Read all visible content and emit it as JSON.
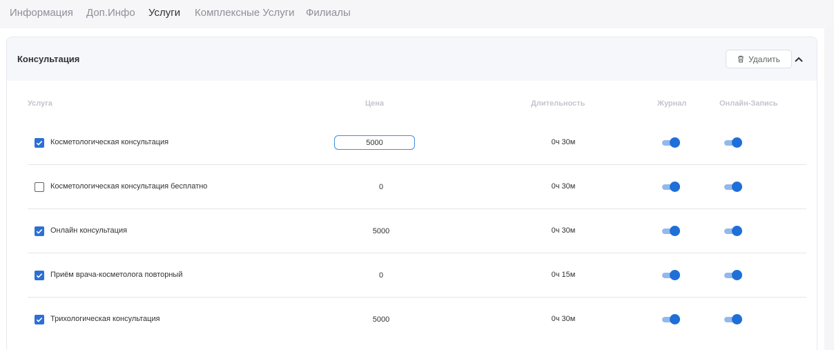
{
  "tabs": [
    {
      "label": "Информация",
      "active": false
    },
    {
      "label": "Доп.Инфо",
      "active": false
    },
    {
      "label": "Услуги",
      "active": true
    },
    {
      "label": "Комплексные Услуги",
      "active": false
    },
    {
      "label": "Филиалы",
      "active": false
    }
  ],
  "card": {
    "title": "Консультация",
    "delete_label": "Удалить"
  },
  "columns": {
    "service": "Услуга",
    "price": "Цена",
    "duration": "Длительность",
    "journal": "Журнал",
    "online": "Онлайн-Запись"
  },
  "services": [
    {
      "checked": true,
      "name": "Косметологическая консультация",
      "price": "5000",
      "editing": true,
      "duration": "0ч 30м",
      "journal": true,
      "online": true
    },
    {
      "checked": false,
      "name": "Косметологическая консультация бесплатно",
      "price": "0",
      "editing": false,
      "duration": "0ч 30м",
      "journal": true,
      "online": true
    },
    {
      "checked": true,
      "name": "Онлайн консультация",
      "price": "5000",
      "editing": false,
      "duration": "0ч 30м",
      "journal": true,
      "online": true
    },
    {
      "checked": true,
      "name": "Приём врача-косметолога повторный",
      "price": "0",
      "editing": false,
      "duration": "0ч 15м",
      "journal": true,
      "online": true
    },
    {
      "checked": true,
      "name": "Трихологическая консультация",
      "price": "5000",
      "editing": false,
      "duration": "0ч 30м",
      "journal": true,
      "online": true
    }
  ],
  "colors": {
    "accent": "#1f6fd8",
    "toggle_track": "#93b9ec",
    "checkbox": "#2c6fd6"
  },
  "icons": {
    "delete": "trash-icon",
    "collapse": "chevron-up-icon",
    "check": "check-icon"
  }
}
